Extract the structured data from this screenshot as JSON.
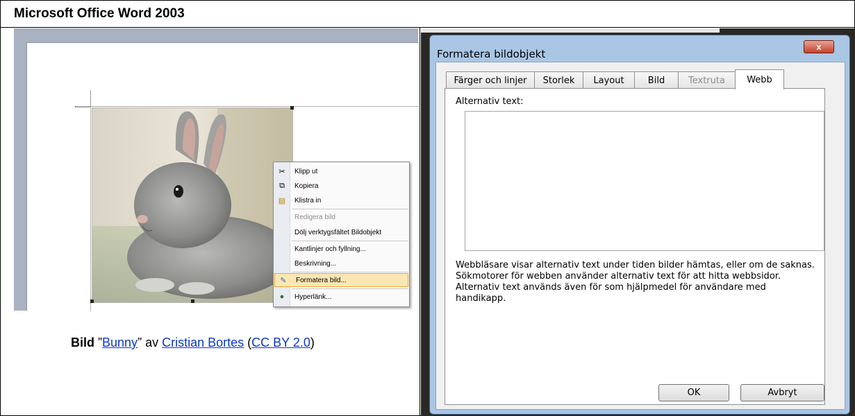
{
  "header": {
    "title": "Microsoft Office Word 2003"
  },
  "context_menu": {
    "items": [
      {
        "label": "Klipp ut",
        "icon": "scissors-icon",
        "disabled": false
      },
      {
        "label": "Kopiera",
        "icon": "copy-icon",
        "disabled": false
      },
      {
        "label": "Klistra in",
        "icon": "paste-icon",
        "disabled": false
      },
      {
        "label": "Redigera bild",
        "icon": "",
        "disabled": true
      },
      {
        "label": "Dölj verktygsfältet Bildobjekt",
        "icon": "",
        "disabled": false
      },
      {
        "label": "Kantlinjer och fyllning...",
        "icon": "",
        "disabled": false
      },
      {
        "label": "Beskrivning...",
        "icon": "",
        "disabled": false
      },
      {
        "label": "Formatera bild...",
        "icon": "format-picture-icon",
        "disabled": false,
        "highlighted": true
      },
      {
        "label": "Hyperlänk...",
        "icon": "globe-link-icon",
        "disabled": false
      }
    ]
  },
  "caption": {
    "bold": "Bild",
    "open_quote": "”",
    "title_link": "Bunny",
    "close_quote": "”",
    "by": "av",
    "author_link": "Cristian Bortes",
    "open_paren": "(",
    "license_link": "CC BY 2.0",
    "close_paren": ")"
  },
  "dialog": {
    "title": "Formatera bildobjekt",
    "close_label": "x",
    "tabs": [
      {
        "label": "Färger och linjer",
        "active": false,
        "disabled": false
      },
      {
        "label": "Storlek",
        "active": false,
        "disabled": false
      },
      {
        "label": "Layout",
        "active": false,
        "disabled": false
      },
      {
        "label": "Bild",
        "active": false,
        "disabled": false
      },
      {
        "label": "Textruta",
        "active": false,
        "disabled": true
      },
      {
        "label": "Webb",
        "active": true,
        "disabled": false
      }
    ],
    "alt_text_label": "Alternativ text:",
    "alt_text_value": "",
    "description": "Webbläsare visar alternativ text under tiden bilder hämtas, eller om de saknas. Sökmotorer för webben använder alternativ text för att hitta webbsidor. Alternativ text används även för som hjälpmedel för användare med handikapp.",
    "ok_label": "OK",
    "cancel_label": "Avbryt"
  },
  "colors": {
    "link": "#0b38c8",
    "menu_highlight": "#fbe7b4",
    "dialog_frame": "#a9c6e5",
    "close_button": "#c4412d"
  }
}
